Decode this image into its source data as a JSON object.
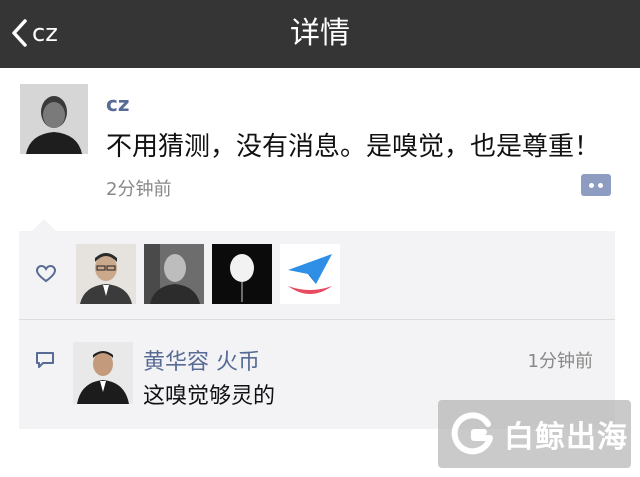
{
  "nav": {
    "back_label": "cz",
    "title": "详情"
  },
  "post": {
    "author": "cz",
    "text": "不用猜测，没有消息。是嗅觉，也是尊重！",
    "time": "2分钟前"
  },
  "likes": {
    "icon": "heart-outline-icon",
    "avatars": [
      "avatar-man-glasses",
      "avatar-bw-portrait",
      "avatar-white-balloon",
      "avatar-paper-plane-logo"
    ]
  },
  "comments": [
    {
      "author": "黄华容 火币",
      "time": "1分钟前",
      "text": "这嗅觉够灵的"
    }
  ],
  "watermark": {
    "text": "白鲸出海"
  },
  "colors": {
    "nav_bg": "#353535",
    "link_blue": "#576b95",
    "panel_bg": "#f3f3f5"
  }
}
